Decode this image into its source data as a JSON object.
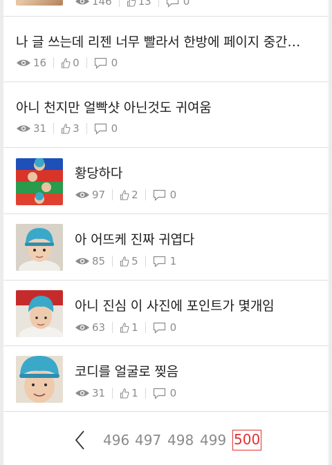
{
  "posts": [
    {
      "title": "",
      "views": "146",
      "likes": "13",
      "comments": "0"
    },
    {
      "title": "나 글 쓰는데 리젠 너무 빨라서 한방에 페이지 중간으로 밀려남",
      "views": "16",
      "likes": "0",
      "comments": "0"
    },
    {
      "title": "아니 천지만 얼빡샷 아닌것도 귀여움",
      "views": "31",
      "likes": "3",
      "comments": "0"
    },
    {
      "title": "황당하다",
      "views": "97",
      "likes": "2",
      "comments": "0"
    },
    {
      "title": "아 어뜨케 진짜 귀엽다",
      "views": "85",
      "likes": "5",
      "comments": "1"
    },
    {
      "title": "아니 진심 이 사진에 포인트가 몇개임",
      "views": "63",
      "likes": "1",
      "comments": "0"
    },
    {
      "title": "코디를 얼굴로 찢음",
      "views": "31",
      "likes": "1",
      "comments": "0"
    }
  ],
  "pagination": {
    "prev_label": "<",
    "pages": [
      "496",
      "497",
      "498",
      "499",
      "500"
    ],
    "current": "500"
  },
  "colors": {
    "accent": "#e03030",
    "thumb_hat": "#3aa8c8"
  },
  "icons": {
    "views": "eye-icon",
    "likes": "thumbs-up-icon",
    "comments": "comment-icon"
  }
}
